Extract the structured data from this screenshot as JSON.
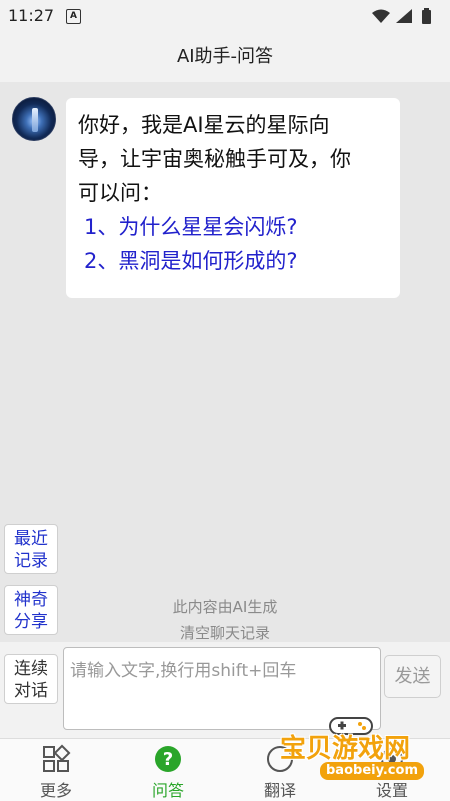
{
  "status_bar": {
    "time": "11:27",
    "notification_letter": "A"
  },
  "header": {
    "title": "AI助手-问答"
  },
  "chat": {
    "greeting_lines": [
      "你好，我是AI星云的星际向",
      "导，让宇宙奥秘触手可及，你",
      "可以问："
    ],
    "suggestions": [
      "1、为什么星星会闪烁?",
      "2、黑洞是如何形成的?"
    ]
  },
  "side_buttons": {
    "recent": [
      "最近",
      "记录"
    ],
    "share": [
      "神奇",
      "分享"
    ],
    "continuous": [
      "连续",
      "对话"
    ]
  },
  "notices": {
    "ai_generated": "此内容由AI生成",
    "clear_history": "清空聊天记录"
  },
  "input": {
    "placeholder": "请输入文字,换行用shift+回车",
    "send_label": "发送"
  },
  "tabs": [
    {
      "label": "更多",
      "icon": "grid-icon"
    },
    {
      "label": "问答",
      "icon": "question-icon",
      "active": true
    },
    {
      "label": "翻译",
      "icon": "translate-icon"
    },
    {
      "label": "设置",
      "icon": "settings-icon"
    }
  ],
  "watermark": {
    "text": "宝贝游戏网",
    "url": "baobeiy.com"
  },
  "colors": {
    "accent_green": "#2aa52a",
    "link_blue": "#2222cc",
    "watermark_orange": "#f2a20c"
  }
}
